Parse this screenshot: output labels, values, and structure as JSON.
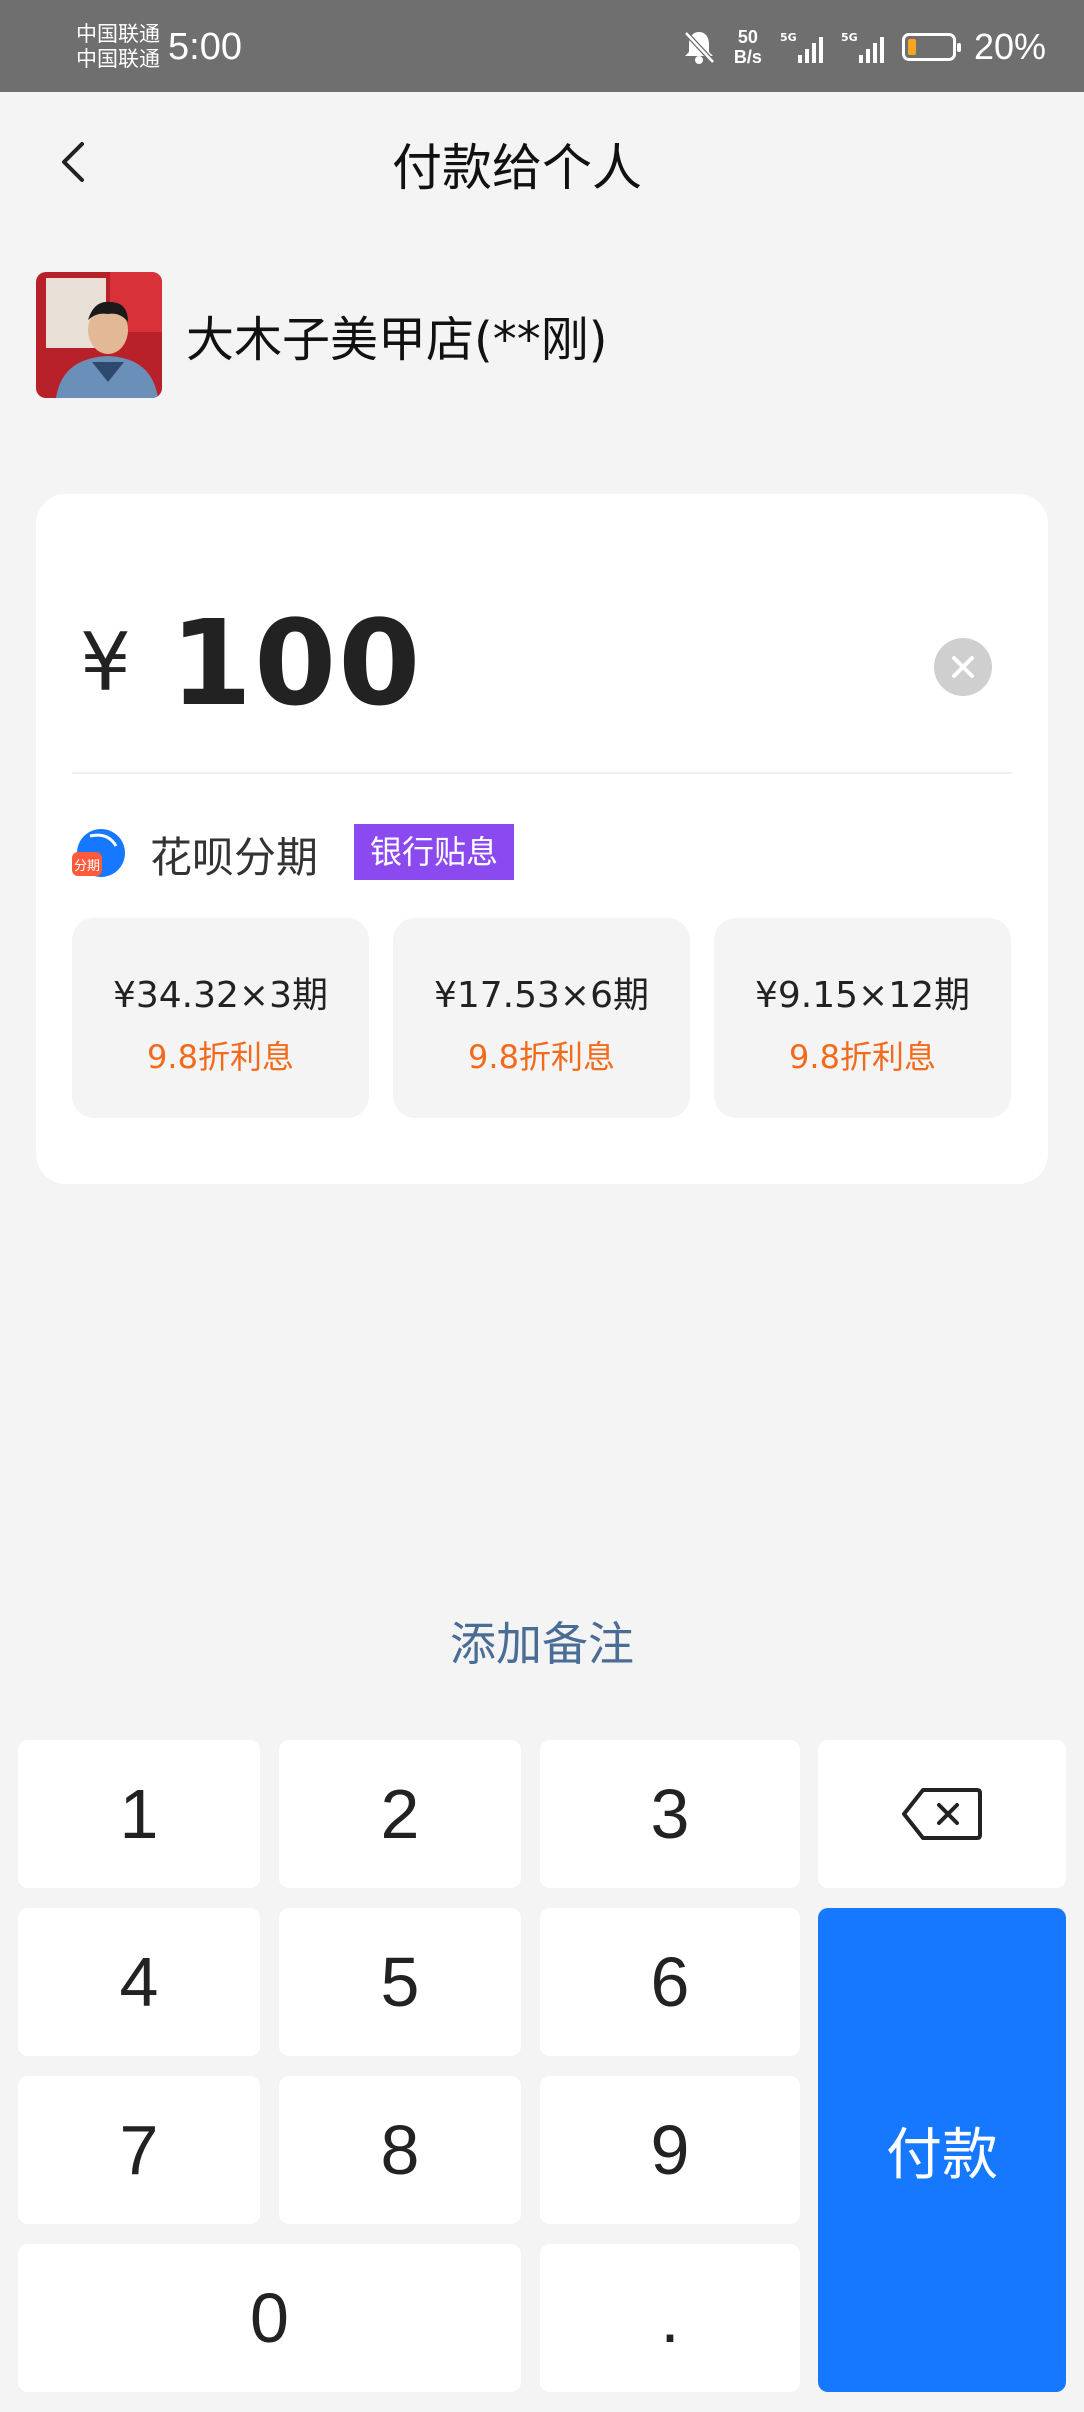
{
  "status_bar": {
    "carrier_1": "中国联通",
    "carrier_2": "中国联通",
    "time": "5:00",
    "net_speed_value": "50",
    "net_speed_unit": "B/s",
    "signal_1": "5G",
    "signal_2": "5G",
    "battery_percent": "20%",
    "battery_level": 0.2,
    "battery_color": "#f5a623"
  },
  "header": {
    "title": "付款给个人"
  },
  "payee": {
    "name": "大木子美甲店(**刚)"
  },
  "amount": {
    "currency": "¥",
    "value": "100"
  },
  "installment": {
    "label": "花呗分期",
    "icon_text": "分期",
    "badge": "银行贴息",
    "plans": [
      {
        "price": "¥34.32×3期",
        "discount": "9.8折利息"
      },
      {
        "price": "¥17.53×6期",
        "discount": "9.8折利息"
      },
      {
        "price": "¥9.15×12期",
        "discount": "9.8折利息"
      }
    ]
  },
  "note": {
    "label": "添加备注"
  },
  "keypad": {
    "keys": [
      "1",
      "2",
      "3",
      "4",
      "5",
      "6",
      "7",
      "8",
      "9",
      "0",
      "."
    ],
    "pay_label": "付款"
  },
  "colors": {
    "primary": "#1677ff",
    "badge": "#8b4af0",
    "discount": "#f26a1b",
    "link": "#4a6d96"
  }
}
